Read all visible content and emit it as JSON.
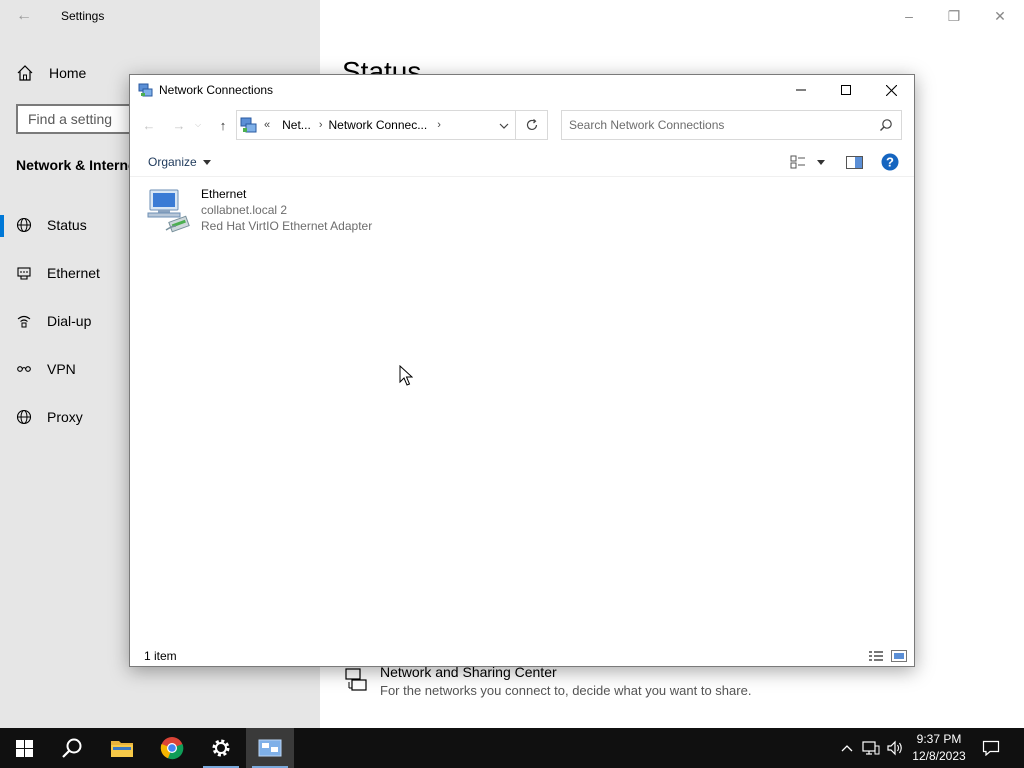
{
  "settings": {
    "app_title": "Settings",
    "home_label": "Home",
    "find_placeholder": "Find a setting",
    "section_header": "Network & Internet",
    "nav": [
      {
        "label": "Status",
        "icon": "globe-icon",
        "active": true
      },
      {
        "label": "Ethernet",
        "icon": "ethernet-icon"
      },
      {
        "label": "Dial-up",
        "icon": "dialup-icon"
      },
      {
        "label": "VPN",
        "icon": "vpn-icon"
      },
      {
        "label": "Proxy",
        "icon": "globe-icon"
      }
    ],
    "main_title": "Status",
    "sharing_center": {
      "title": "Network and Sharing Center",
      "description": "For the networks you connect to, decide what you want to share."
    }
  },
  "window": {
    "title": "Network Connections",
    "breadcrumb": [
      "Net...",
      "Network Connec..."
    ],
    "search_placeholder": "Search Network Connections",
    "organize_label": "Organize",
    "items": [
      {
        "name": "Ethernet",
        "network": "collabnet.local 2",
        "adapter": "Red Hat VirtIO Ethernet Adapter",
        "icon": "network-adapter-icon"
      }
    ],
    "status_count": "1 item"
  },
  "taskbar": {
    "apps": [
      "start-button",
      "search-button",
      "file-explorer",
      "chrome",
      "settings",
      "network-connections"
    ],
    "time": "9:37 PM",
    "date": "12/8/2023"
  },
  "colors": {
    "accent": "#0078d7",
    "taskbar": "#101010",
    "sidebar": "#e6e6e6",
    "help": "#1565c0"
  }
}
